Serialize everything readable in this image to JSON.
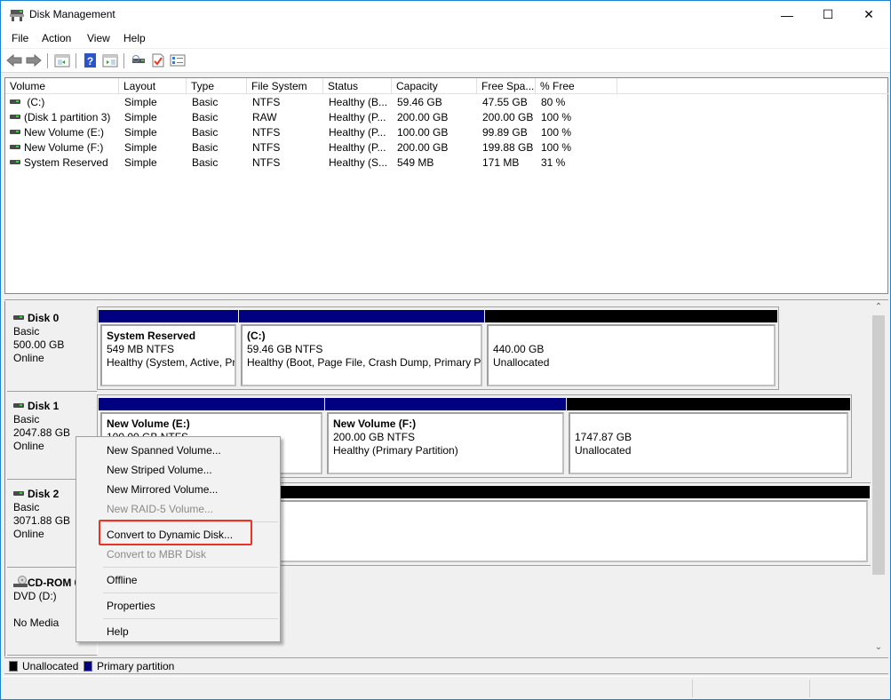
{
  "window": {
    "title": "Disk Management",
    "controls": {
      "minimize": "—",
      "maximize": "☐",
      "close": "✕"
    }
  },
  "menu": [
    "File",
    "Action",
    "View",
    "Help"
  ],
  "toolbar": [
    "back-icon",
    "forward-icon",
    "console-tree-icon",
    "help-icon",
    "action-pane-icon",
    "connect-icon",
    "properties-icon",
    "checklist-icon"
  ],
  "volume_list": {
    "columns": [
      "Volume",
      "Layout",
      "Type",
      "File System",
      "Status",
      "Capacity",
      "Free Spa...",
      "% Free"
    ],
    "rows": [
      {
        "volume": " (C:)",
        "layout": "Simple",
        "type": "Basic",
        "fs": "NTFS",
        "status": "Healthy (B...",
        "capacity": "59.46 GB",
        "free": "47.55 GB",
        "pct": "80 %"
      },
      {
        "volume": "(Disk 1 partition 3)",
        "layout": "Simple",
        "type": "Basic",
        "fs": "RAW",
        "status": "Healthy (P...",
        "capacity": "200.00 GB",
        "free": "200.00 GB",
        "pct": "100 %"
      },
      {
        "volume": "New Volume (E:)",
        "layout": "Simple",
        "type": "Basic",
        "fs": "NTFS",
        "status": "Healthy (P...",
        "capacity": "100.00 GB",
        "free": "99.89 GB",
        "pct": "100 %"
      },
      {
        "volume": "New Volume (F:)",
        "layout": "Simple",
        "type": "Basic",
        "fs": "NTFS",
        "status": "Healthy (P...",
        "capacity": "200.00 GB",
        "free": "199.88 GB",
        "pct": "100 %"
      },
      {
        "volume": "System Reserved",
        "layout": "Simple",
        "type": "Basic",
        "fs": "NTFS",
        "status": "Healthy (S...",
        "capacity": "549 MB",
        "free": "171 MB",
        "pct": "31 %"
      }
    ]
  },
  "disks": [
    {
      "name": "Disk 0",
      "type": "Basic",
      "size": "500.00 GB",
      "state": "Online",
      "partitions": [
        {
          "name": "System Reserved",
          "line2": "549 MB NTFS",
          "line3": "Healthy (System, Active, Pr",
          "kind": "primary"
        },
        {
          "name": " (C:)",
          "line2": "59.46 GB NTFS",
          "line3": "Healthy (Boot, Page File, Crash Dump, Primary Pa",
          "kind": "primary"
        },
        {
          "name": "",
          "line2": "440.00 GB",
          "line3": "Unallocated",
          "kind": "unallocated"
        }
      ]
    },
    {
      "name": "Disk 1",
      "type": "Basic",
      "size": "2047.88 GB",
      "state": "Online",
      "partitions": [
        {
          "name": "New Volume  (E:)",
          "line2": "100.00 GB NTFS",
          "line3": "",
          "kind": "primary"
        },
        {
          "name": "New Volume  (F:)",
          "line2": "200.00 GB NTFS",
          "line3": "Healthy (Primary Partition)",
          "kind": "primary"
        },
        {
          "name": "",
          "line2": "1747.87 GB",
          "line3": "Unallocated",
          "kind": "unallocated"
        }
      ]
    },
    {
      "name": "Disk 2",
      "type": "Basic",
      "size": "3071.88 GB",
      "state": "Online",
      "partitions": [
        {
          "name": "",
          "line2": "",
          "line3": "",
          "kind": "unallocated"
        }
      ]
    },
    {
      "name": "CD-ROM 0",
      "type": "DVD (D:)",
      "size": "",
      "state": "No Media",
      "partitions": []
    }
  ],
  "context_menu": {
    "items": [
      {
        "label": "New Spanned Volume...",
        "enabled": true
      },
      {
        "label": "New Striped Volume...",
        "enabled": true
      },
      {
        "label": "New Mirrored Volume...",
        "enabled": true
      },
      {
        "label": "New RAID-5 Volume...",
        "enabled": false
      },
      {
        "label": "Convert to Dynamic Disk...",
        "enabled": true,
        "highlighted": true
      },
      {
        "label": "Convert to MBR Disk",
        "enabled": false
      },
      {
        "label": "Offline",
        "enabled": true
      },
      {
        "label": "Properties",
        "enabled": true
      },
      {
        "label": "Help",
        "enabled": true
      }
    ]
  },
  "legend": [
    {
      "label": "Unallocated",
      "color": "#000000"
    },
    {
      "label": "Primary partition",
      "color": "#000080"
    }
  ],
  "colors": {
    "primary": "#000080",
    "unallocated": "#000000",
    "highlight": "#ea3323"
  }
}
